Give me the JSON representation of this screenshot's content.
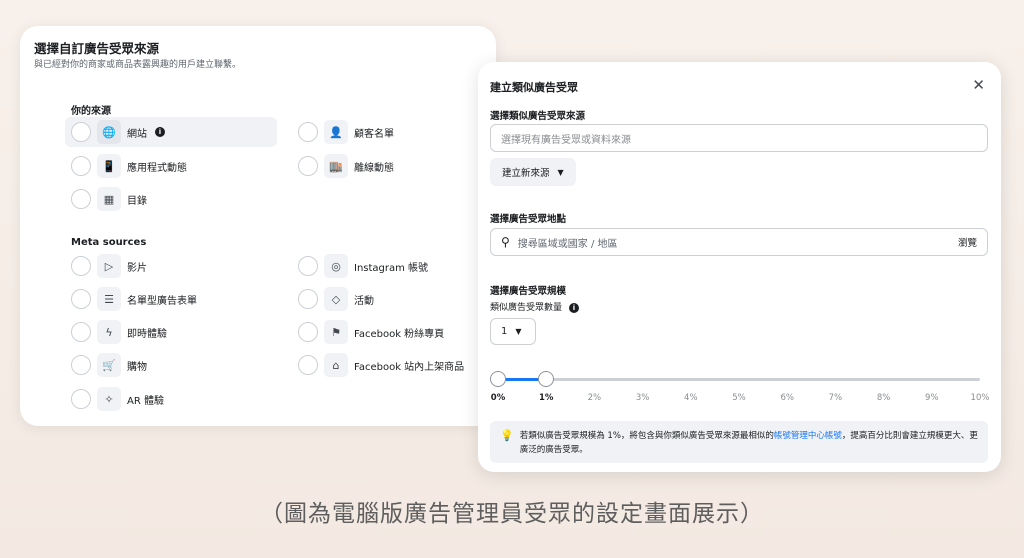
{
  "left": {
    "title": "選擇自訂廣告受眾來源",
    "subtitle": "與已經對你的商家或商品表露興趣的用戶建立聯繫。",
    "your_sources_label": "你的來源",
    "meta_sources_label": "Meta sources",
    "your_sources": [
      {
        "label": "網站",
        "icon": "globe-icon",
        "glyph": "🌐"
      },
      {
        "label": "顧客名單",
        "icon": "user-list-icon",
        "glyph": "👤"
      },
      {
        "label": "應用程式動態",
        "icon": "phone-icon",
        "glyph": "📱"
      },
      {
        "label": "離線動態",
        "icon": "store-icon",
        "glyph": "🏬"
      },
      {
        "label": "目錄",
        "icon": "grid-icon",
        "glyph": "▦"
      }
    ],
    "meta_sources": [
      {
        "label": "影片",
        "icon": "play-icon",
        "glyph": "▷"
      },
      {
        "label": "Instagram 帳號",
        "icon": "instagram-icon",
        "glyph": "◎"
      },
      {
        "label": "名單型廣告表單",
        "icon": "form-list-icon",
        "glyph": "☰"
      },
      {
        "label": "活動",
        "icon": "ticket-icon",
        "glyph": "◇"
      },
      {
        "label": "即時體驗",
        "icon": "bolt-icon",
        "glyph": "ϟ"
      },
      {
        "label": "Facebook 粉絲專頁",
        "icon": "page-icon",
        "glyph": "⚑"
      },
      {
        "label": "購物",
        "icon": "cart-icon",
        "glyph": "🛒"
      },
      {
        "label": "Facebook 站內上架商品",
        "icon": "shop-icon",
        "glyph": "⌂"
      },
      {
        "label": "AR 體驗",
        "icon": "sparkle-icon",
        "glyph": "✧"
      }
    ]
  },
  "right": {
    "title": "建立類似廣告受眾",
    "source_label": "選擇類似廣告受眾來源",
    "source_placeholder": "選擇現有廣告受眾或資料來源",
    "create_new_label": "建立新來源",
    "location_label": "選擇廣告受眾地點",
    "location_placeholder": "搜尋區域或國家 / 地區",
    "browse_label": "瀏覽",
    "size_label": "選擇廣告受眾規模",
    "count_label": "類似廣告受眾數量",
    "count_value": "1",
    "slider_value_percent": 1,
    "ticks": [
      "0%",
      "1%",
      "2%",
      "3%",
      "4%",
      "5%",
      "6%",
      "7%",
      "8%",
      "9%",
      "10%"
    ],
    "note_text_1": "若類似廣告受眾規模為 1%，將包含與你類似廣告受眾來源最相似的",
    "note_link": "帳號管理中心帳號",
    "note_text_2": "，提高百分比則會建立規模更大、更廣泛的廣告受眾。"
  },
  "caption": "（圖為電腦版廣告管理員受眾的設定畫面展示）",
  "colors": {
    "accent": "#1877f2",
    "muted_bg": "#f0f2f5"
  }
}
